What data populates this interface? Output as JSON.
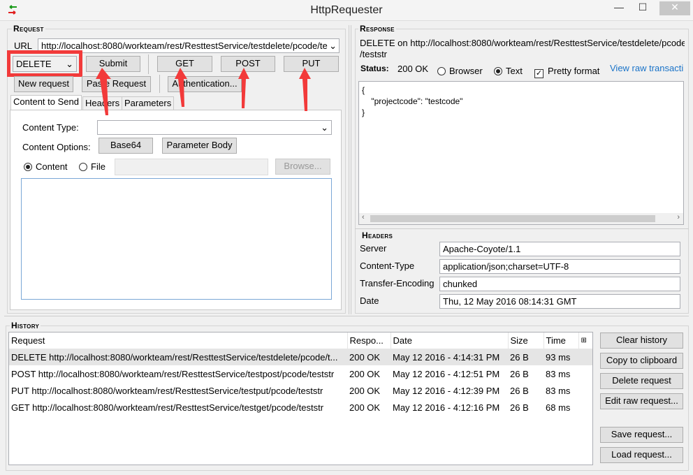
{
  "window": {
    "title": "HttpRequester",
    "minimize": "—",
    "maximize": "☐",
    "close": "✕"
  },
  "request": {
    "section_title": "Request",
    "url_label": "URL",
    "url_value": "http://localhost:8080/workteam/rest/ResttestService/testdelete/pcode/te",
    "method": "DELETE",
    "submit": "Submit",
    "get": "GET",
    "post": "POST",
    "put": "PUT",
    "new_request": "New request",
    "paste_request": "Paste Request",
    "authentication": "Authentication...",
    "tabs": [
      "Content to Send",
      "Headers",
      "Parameters"
    ],
    "content_type_label": "Content Type:",
    "content_type_value": "",
    "content_options_label": "Content Options:",
    "base64": "Base64",
    "parameter_body": "Parameter Body",
    "content_radio": "Content",
    "file_radio": "File",
    "file_value": "",
    "browse": "Browse...",
    "content_body": ""
  },
  "response": {
    "section_title": "Response",
    "summary_line1": "DELETE on http://localhost:8080/workteam/rest/ResttestService/testdelete/pcode",
    "summary_line2": "/teststr",
    "status_label": "Status:",
    "status_value": "200 OK",
    "browser": "Browser",
    "text": "Text",
    "pretty": "Pretty format",
    "view_raw": "View raw transacti",
    "body": "{\n    \"projectcode\": \"testcode\"\n}",
    "headers_title": "Headers",
    "headers": [
      {
        "name": "Server",
        "value": "Apache-Coyote/1.1"
      },
      {
        "name": "Content-Type",
        "value": "application/json;charset=UTF-8"
      },
      {
        "name": "Transfer-Encoding",
        "value": "chunked"
      },
      {
        "name": "Date",
        "value": "Thu, 12 May 2016 08:14:31 GMT"
      }
    ]
  },
  "history": {
    "section_title": "History",
    "columns": [
      "Request",
      "Respo...",
      "Date",
      "Size",
      "Time"
    ],
    "rows": [
      [
        "DELETE http://localhost:8080/workteam/rest/ResttestService/testdelete/pcode/t...",
        "200 OK",
        "May 12 2016 - 4:14:31 PM",
        "26 B",
        "93 ms"
      ],
      [
        "POST http://localhost:8080/workteam/rest/ResttestService/testpost/pcode/teststr",
        "200 OK",
        "May 12 2016 - 4:12:51 PM",
        "26 B",
        "83 ms"
      ],
      [
        "PUT http://localhost:8080/workteam/rest/ResttestService/testput/pcode/teststr",
        "200 OK",
        "May 12 2016 - 4:12:39 PM",
        "26 B",
        "83 ms"
      ],
      [
        "GET http://localhost:8080/workteam/rest/ResttestService/testget/pcode/teststr",
        "200 OK",
        "May 12 2016 - 4:12:16 PM",
        "26 B",
        "68 ms"
      ]
    ],
    "buttons": {
      "clear": "Clear history",
      "copy": "Copy to clipboard",
      "delete": "Delete request",
      "edit": "Edit raw request...",
      "save": "Save request...",
      "load": "Load request..."
    }
  },
  "colors": {
    "annotation": "#f23a3a",
    "link": "#1a73c8"
  }
}
